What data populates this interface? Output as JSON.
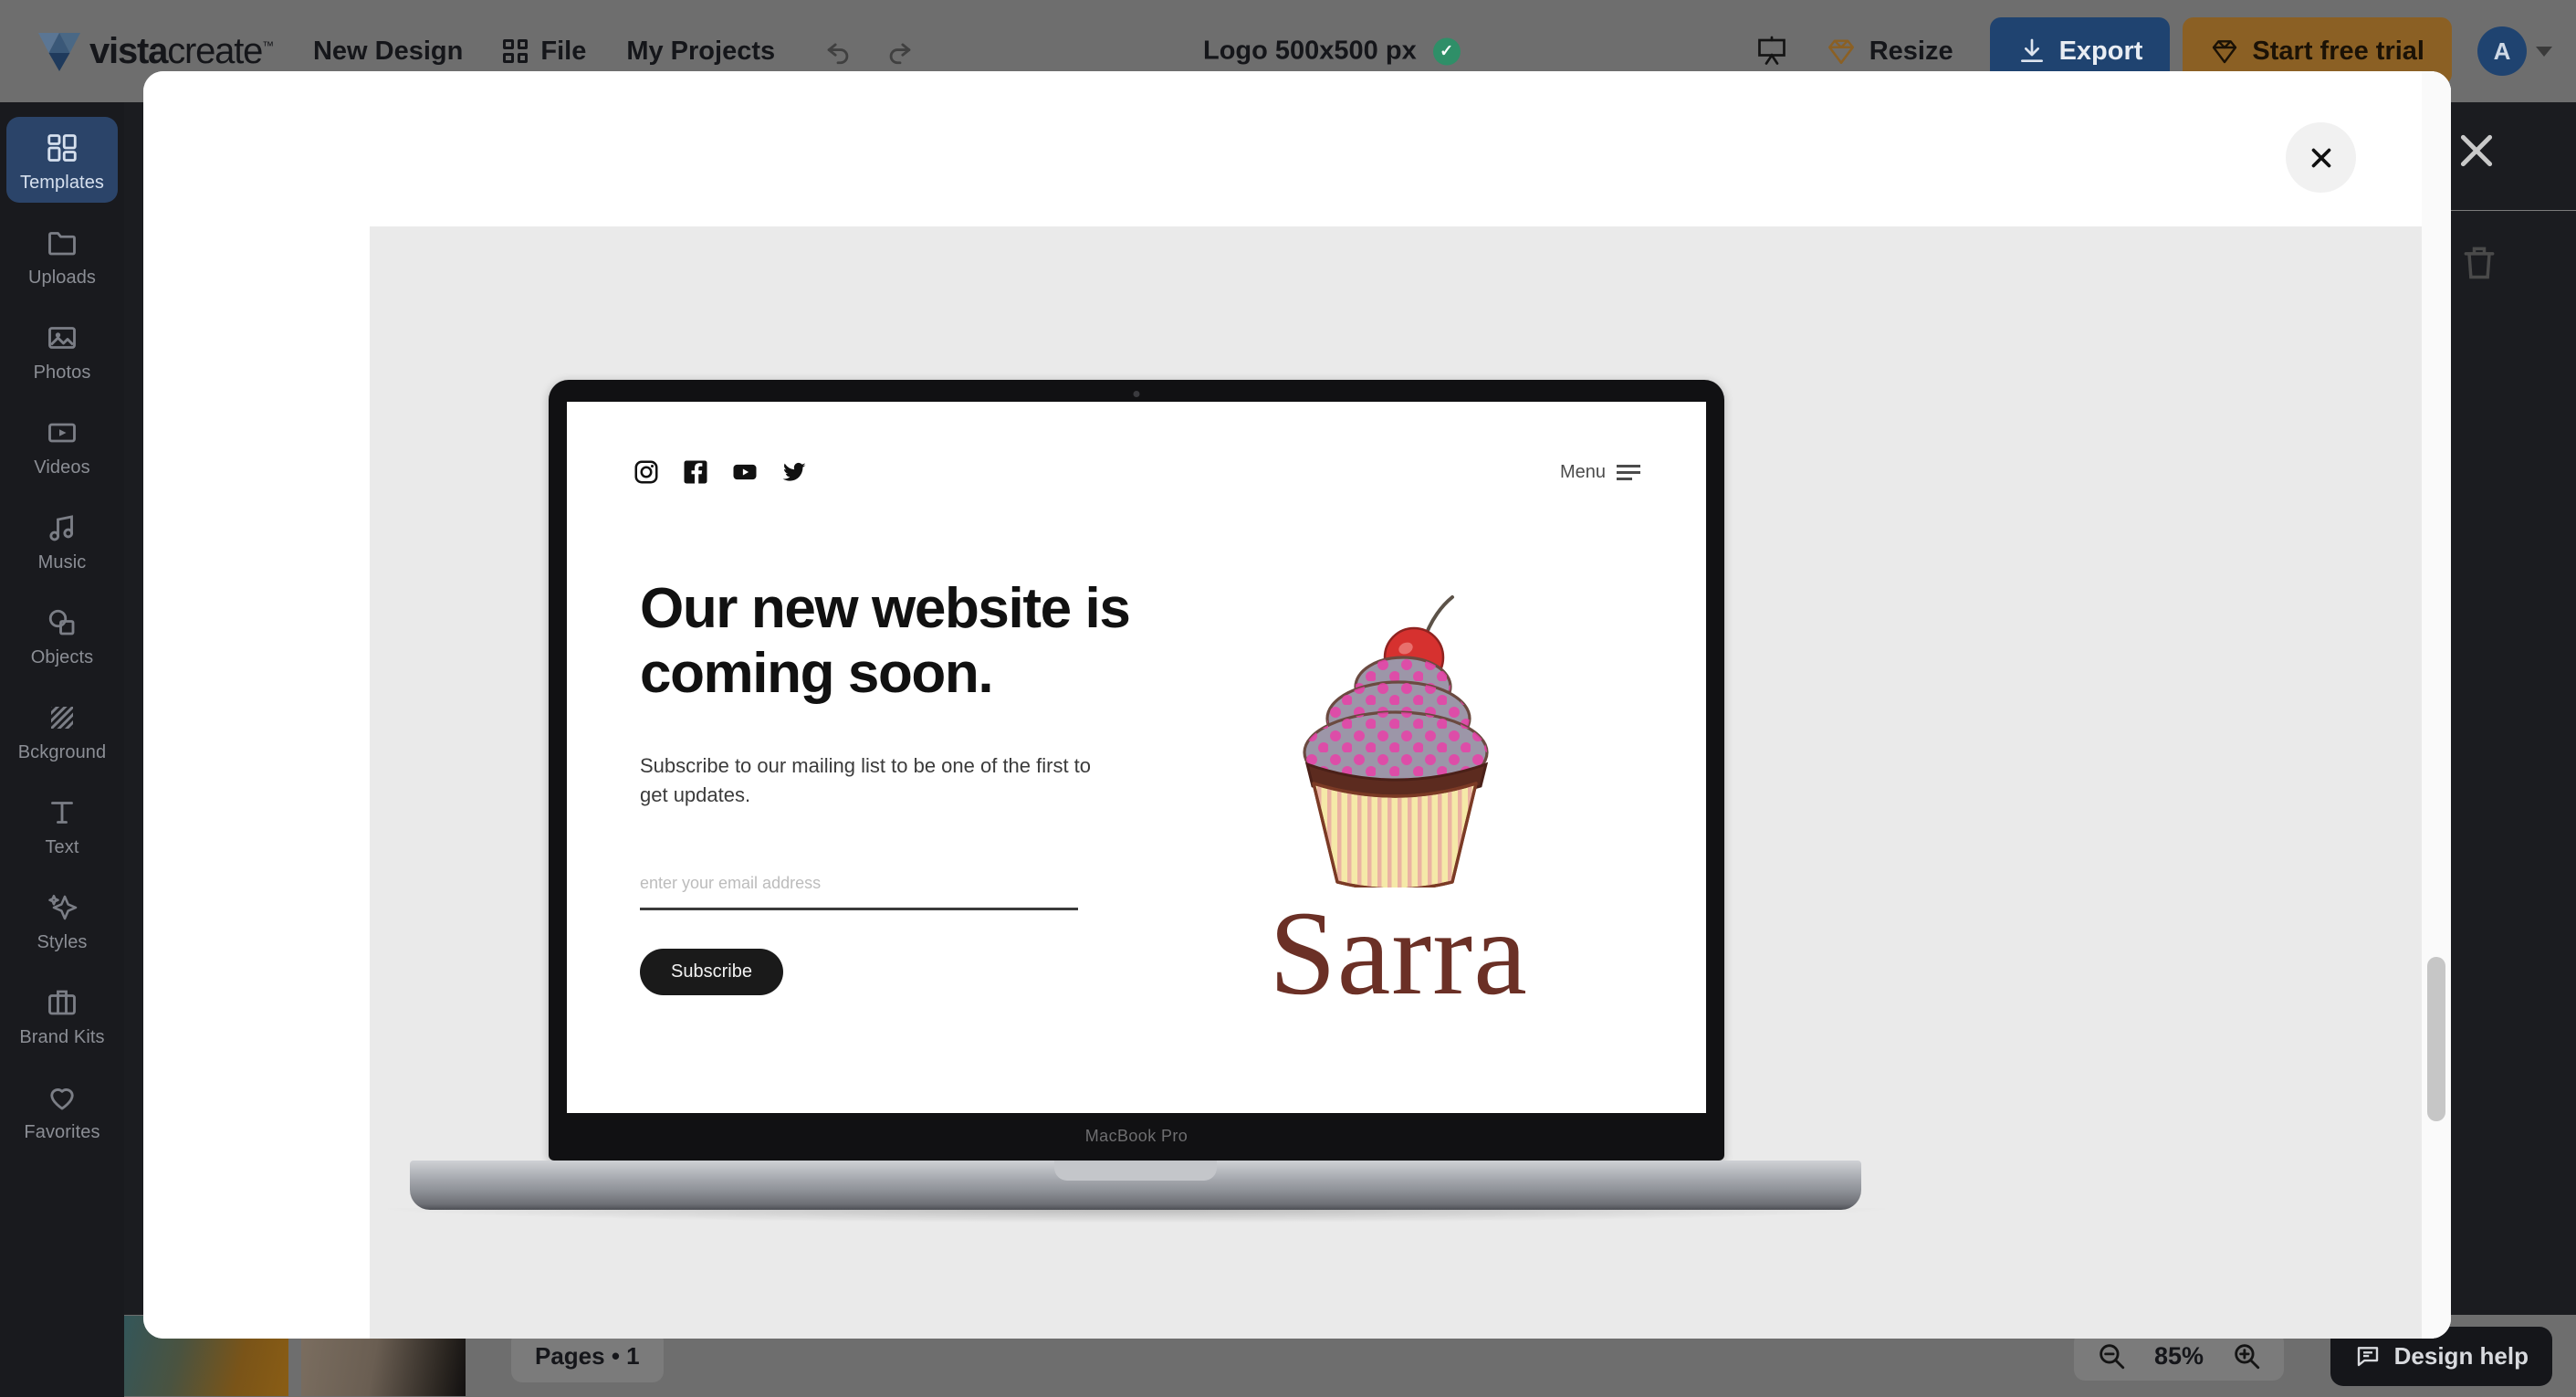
{
  "header": {
    "brand": "vista",
    "brand_light": "create",
    "brand_tm": "™",
    "new_design": "New Design",
    "file": "File",
    "my_projects": "My Projects",
    "doc_title": "Logo 500x500 px",
    "cloud_saved_icon": "cloud-check-icon",
    "undo_icon": "undo-arrow-icon",
    "redo_icon": "redo-arrow-icon",
    "presentation_icon": "presentation-icon",
    "diamond_icon": "diamond-icon",
    "resize": "Resize",
    "export": "Export",
    "export_icon": "download-icon",
    "trial": "Start free trial",
    "trial_icon": "diamond-icon",
    "avatar_initial": "A",
    "caret_icon": "chevron-down-icon"
  },
  "sidebar": {
    "items": [
      {
        "label": "Templates",
        "icon": "templates-grid-icon",
        "active": true
      },
      {
        "label": "Uploads",
        "icon": "folder-icon",
        "active": false
      },
      {
        "label": "Photos",
        "icon": "image-icon",
        "active": false
      },
      {
        "label": "Videos",
        "icon": "video-play-icon",
        "active": false
      },
      {
        "label": "Music",
        "icon": "music-note-icon",
        "active": false
      },
      {
        "label": "Objects",
        "icon": "shapes-icon",
        "active": false
      },
      {
        "label": "Bckground",
        "icon": "hatch-pattern-icon",
        "active": false
      },
      {
        "label": "Text",
        "icon": "text-t-icon",
        "active": false
      },
      {
        "label": "Styles",
        "icon": "sparkle-icon",
        "active": false
      },
      {
        "label": "Brand Kits",
        "icon": "briefcase-icon",
        "active": false
      },
      {
        "label": "Favorites",
        "icon": "heart-icon",
        "active": false
      }
    ]
  },
  "context_toolbar": {
    "duplicate_icon": "duplicate-icon",
    "delete_icon": "trash-icon",
    "close_icon": "close-x-icon"
  },
  "modal": {
    "close_label": "✕",
    "close_icon": "close-x-icon",
    "scrollbar": "vertical-scrollbar"
  },
  "mockup": {
    "device_label": "MacBook Pro",
    "socials": [
      {
        "name": "instagram-icon"
      },
      {
        "name": "facebook-icon"
      },
      {
        "name": "youtube-icon"
      },
      {
        "name": "twitter-icon"
      }
    ],
    "menu_label": "Menu",
    "menu_icon": "hamburger-icon",
    "headline": "Our new website is coming soon.",
    "subtext": "Subscribe to our mailing list to be one of the first to get updates.",
    "email_placeholder": "enter your email address",
    "subscribe_label": "Subscribe",
    "brand_name": "Sarra",
    "cupcake": {
      "icon": "cupcake-icon",
      "frosting_color": "#9c96a8",
      "dots_color": "#e940a8",
      "cherry_color": "#d6312f",
      "base_color": "#5c2b1f",
      "liner_color": "#f5e9a8",
      "stripe_color": "#e9a6a0"
    }
  },
  "bottombar": {
    "pages_label": "Pages • 1",
    "zoom_out_icon": "zoom-out-icon",
    "zoom_in_icon": "zoom-in-icon",
    "zoom_value": "85%",
    "design_help": "Design help",
    "design_help_icon": "chat-bubble-icon"
  }
}
